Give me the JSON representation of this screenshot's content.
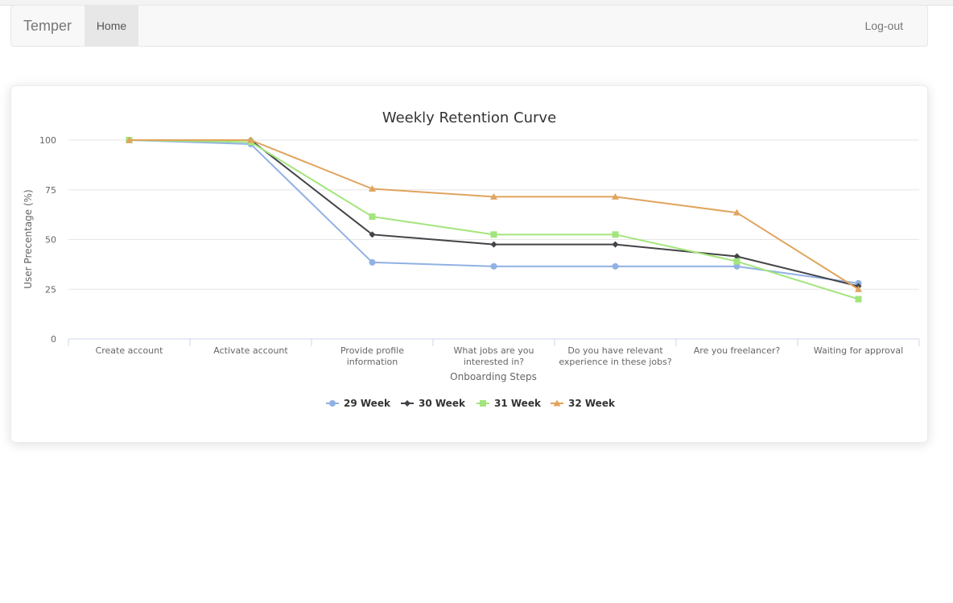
{
  "navbar": {
    "brand": "Temper",
    "home_label": "Home",
    "logout_label": "Log-out"
  },
  "chart_data": {
    "type": "line",
    "title": "Weekly Retention Curve",
    "xlabel": "Onboarding Steps",
    "ylabel": "User Precentage (%)",
    "ylim": [
      0,
      100
    ],
    "yticks": [
      0,
      25,
      50,
      75,
      100
    ],
    "grid": true,
    "legend_position": "bottom-center",
    "categories": [
      "Create account",
      "Activate account",
      "Provide profile information",
      "What jobs are you interested in?",
      "Do you have relevant experience in these jobs?",
      "Are you freelancer?",
      "Waiting for approval"
    ],
    "category_lines": [
      [
        "Create account"
      ],
      [
        "Activate account"
      ],
      [
        "Provide profile",
        "information"
      ],
      [
        "What jobs are you",
        "interested in?"
      ],
      [
        "Do you have relevant",
        "experience in these jobs?"
      ],
      [
        "Are you freelancer?"
      ],
      [
        "Waiting for approval"
      ]
    ],
    "series": [
      {
        "name": "29 Week",
        "color": "#90b1e3",
        "marker": "circle",
        "values": [
          100,
          98,
          38.5,
          36.5,
          36.5,
          36.5,
          28
        ]
      },
      {
        "name": "30 Week",
        "color": "#434348",
        "marker": "diamond",
        "values": [
          100,
          100,
          52.5,
          47.5,
          47.5,
          41.5,
          26.5
        ]
      },
      {
        "name": "31 Week",
        "color": "#a3e57c",
        "marker": "square",
        "values": [
          100,
          99,
          61.5,
          52.5,
          52.5,
          39,
          20
        ]
      },
      {
        "name": "32 Week",
        "color": "#e0a45e",
        "marker": "triangle",
        "values": [
          100,
          100,
          75.5,
          71.5,
          71.5,
          63.5,
          25
        ]
      }
    ]
  }
}
